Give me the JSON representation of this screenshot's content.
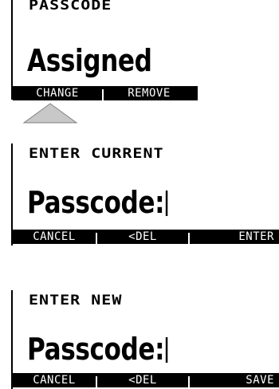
{
  "screens": [
    {
      "title": "PASSCODE",
      "value": "Assigned",
      "softkeys": [
        "CHANGE",
        "REMOVE"
      ]
    },
    {
      "title": "ENTER CURRENT",
      "value": "Passcode:",
      "softkeys": [
        "CANCEL",
        "<DEL",
        "ENTER"
      ]
    },
    {
      "title": "ENTER NEW",
      "value": "Passcode:",
      "softkeys": [
        "CANCEL",
        "<DEL",
        "SAVE"
      ]
    }
  ],
  "colors": {
    "display_fg": "#000000",
    "display_bg": "#ffffff",
    "arrow_fill": "#c8c8c8"
  },
  "icons": {
    "selection_indicator": "up-triangle-icon"
  }
}
